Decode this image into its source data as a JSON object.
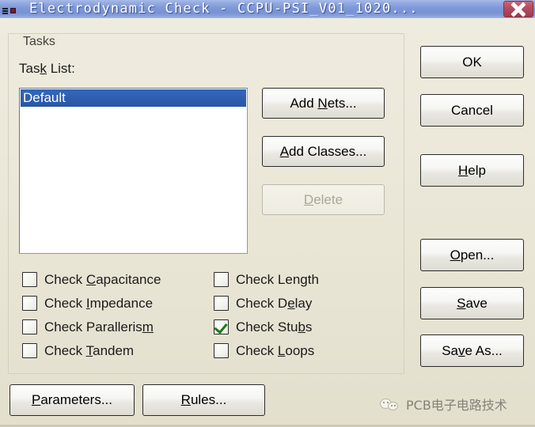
{
  "window": {
    "title": "Electrodynamic Check - CCPU-PSI_V01_1020...",
    "sysmenu_icon": "system-menu-icon",
    "close_icon": "close-icon",
    "close_label": "Close"
  },
  "tasks_group": {
    "legend": "Tasks",
    "task_list_label": "Task List:",
    "task_list_label_accel": "k",
    "list_items": [
      {
        "label": "Default",
        "selected": true
      }
    ],
    "buttons": [
      {
        "id": "add-nets",
        "label": "Add Nets...",
        "accel": "N",
        "enabled": true
      },
      {
        "id": "add-classes",
        "label": "Add Classes...",
        "accel": "A",
        "enabled": true
      },
      {
        "id": "delete",
        "label": "Delete",
        "accel": "D",
        "enabled": false
      }
    ],
    "checkboxes_left": [
      {
        "id": "check-capacitance",
        "label": "Check Capacitance",
        "accel": "C",
        "checked": false
      },
      {
        "id": "check-impedance",
        "label": "Check Impedance",
        "accel": "I",
        "checked": false
      },
      {
        "id": "check-parallelism",
        "label": "Check Parallelism",
        "accel": "m",
        "checked": false
      },
      {
        "id": "check-tandem",
        "label": "Check Tandem",
        "accel": "T",
        "checked": false
      }
    ],
    "checkboxes_right": [
      {
        "id": "check-length",
        "label": "Check Length",
        "accel": "g",
        "checked": false
      },
      {
        "id": "check-delay",
        "label": "Check Delay",
        "accel": "e",
        "checked": false
      },
      {
        "id": "check-stubs",
        "label": "Check Stubs",
        "accel": "b",
        "checked": true
      },
      {
        "id": "check-loops",
        "label": "Check Loops",
        "accel": "L",
        "checked": false
      }
    ]
  },
  "side_buttons": [
    {
      "id": "ok",
      "label": "OK",
      "accel": ""
    },
    {
      "id": "cancel",
      "label": "Cancel",
      "accel": ""
    },
    {
      "id": "help",
      "label": "Help",
      "accel": "H"
    },
    {
      "id": "open",
      "label": "Open...",
      "accel": "O"
    },
    {
      "id": "save",
      "label": "Save",
      "accel": "S"
    },
    {
      "id": "save-as",
      "label": "Save As...",
      "accel": "v"
    }
  ],
  "bottom_buttons": [
    {
      "id": "parameters",
      "label": "Parameters...",
      "accel": "P"
    },
    {
      "id": "rules",
      "label": "Rules...",
      "accel": "R"
    }
  ],
  "watermark": {
    "icon": "wechat-icon",
    "text": "PCB电子电路技术"
  },
  "colors": {
    "dialog_background": "#ece9d8",
    "titlebar_blue": "#7d97d8",
    "close_button_red": "#b44e60",
    "selection_blue": "#2c5aa8",
    "checkmark_green": "#1d7a1d",
    "listbox_white": "#ffffff",
    "disabled_text": "#a9a698"
  }
}
